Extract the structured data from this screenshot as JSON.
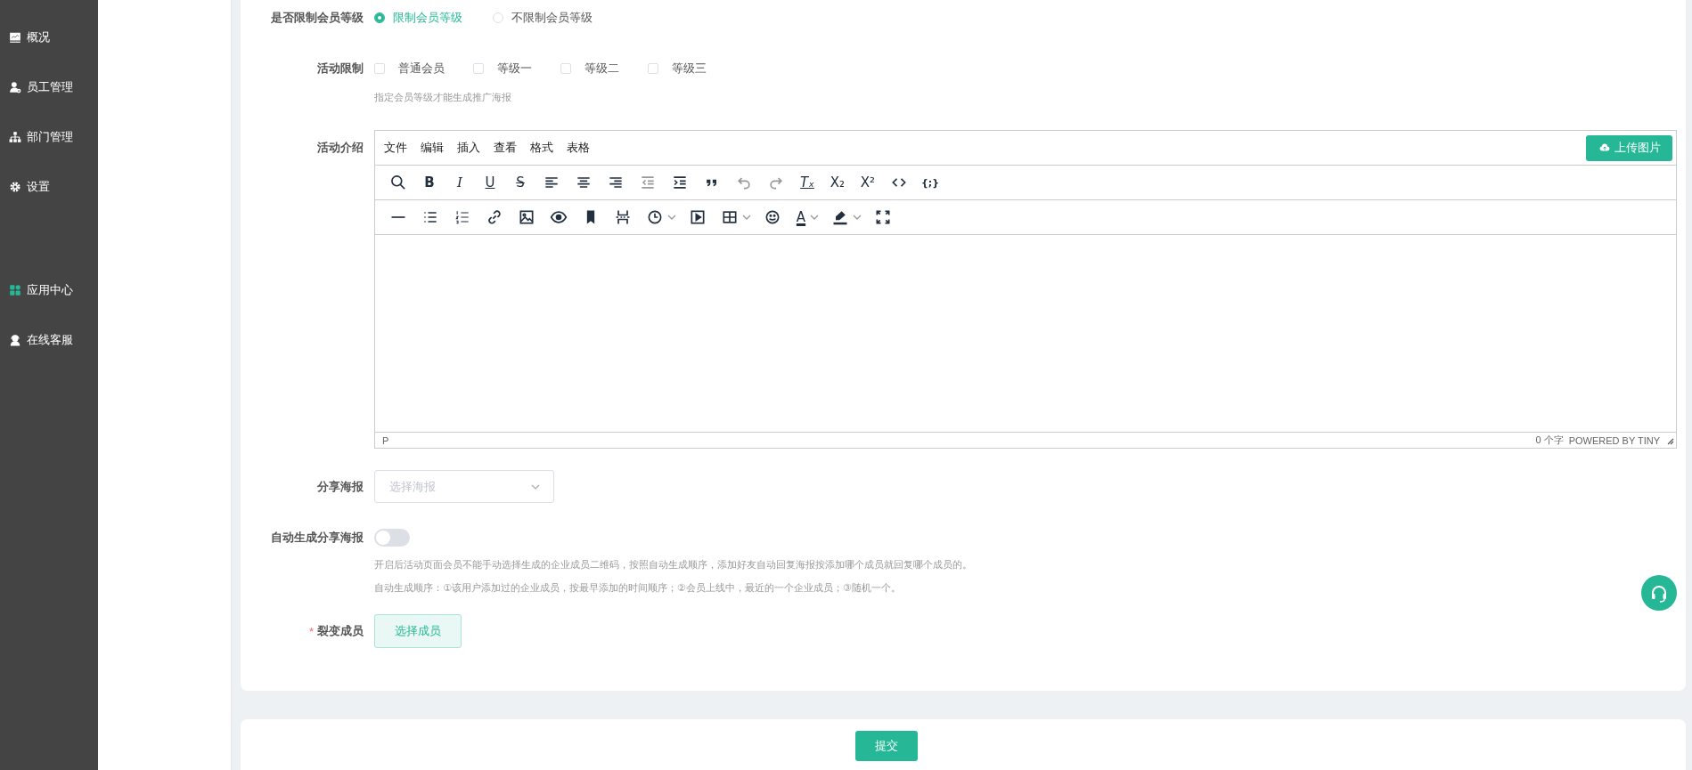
{
  "sidebar": {
    "items": [
      {
        "label": "概况",
        "kind": "chart"
      },
      {
        "label": "员工管理",
        "kind": "staff"
      },
      {
        "label": "部门管理",
        "kind": "org"
      },
      {
        "label": "设置",
        "kind": "gear"
      },
      {
        "label": "应用中心",
        "kind": "apps"
      },
      {
        "label": "在线客服",
        "kind": "agent"
      }
    ]
  },
  "form": {
    "member_limit": {
      "label": "是否限制会员等级",
      "options": [
        {
          "label": "限制会员等级",
          "selected": true
        },
        {
          "label": "不限制会员等级",
          "selected": false
        }
      ]
    },
    "activity_limit": {
      "label": "活动限制",
      "options": [
        {
          "label": "普通会员",
          "checked": false
        },
        {
          "label": "等级一",
          "checked": false
        },
        {
          "label": "等级二",
          "checked": false
        },
        {
          "label": "等级三",
          "checked": false
        }
      ],
      "hint": "指定会员等级才能生成推广海报"
    },
    "intro": {
      "label": "活动介绍",
      "editor": {
        "menus": [
          "文件",
          "编辑",
          "插入",
          "查看",
          "格式",
          "表格"
        ],
        "upload_button": "上传图片",
        "toolbar_rows": [
          [
            {
              "kind": "search",
              "disabled": false
            },
            {
              "kind": "bold",
              "glyph": "B",
              "disabled": false
            },
            {
              "kind": "italic",
              "glyph": "I",
              "disabled": false
            },
            {
              "kind": "underline",
              "glyph": "U",
              "disabled": false
            },
            {
              "kind": "strike",
              "glyph": "S",
              "disabled": false
            },
            {
              "kind": "align-left",
              "disabled": false
            },
            {
              "kind": "align-center",
              "disabled": false
            },
            {
              "kind": "align-right",
              "disabled": false
            },
            {
              "kind": "outdent",
              "disabled": true
            },
            {
              "kind": "indent",
              "disabled": false
            },
            {
              "kind": "quote",
              "disabled": false
            },
            {
              "kind": "undo",
              "disabled": true
            },
            {
              "kind": "redo",
              "disabled": true
            },
            {
              "kind": "clear-format",
              "glyph": "Tₓ",
              "disabled": false
            },
            {
              "kind": "subscript",
              "glyph": "X₂",
              "disabled": false
            },
            {
              "kind": "superscript",
              "glyph": "X²",
              "disabled": false
            },
            {
              "kind": "code",
              "disabled": false
            },
            {
              "kind": "code-sample",
              "glyph": "{;}",
              "disabled": false
            }
          ],
          [
            {
              "kind": "hr",
              "disabled": false
            },
            {
              "kind": "bullet-list",
              "disabled": false
            },
            {
              "kind": "numbered-list",
              "disabled": false
            },
            {
              "kind": "link",
              "disabled": false
            },
            {
              "kind": "image",
              "disabled": false
            },
            {
              "kind": "preview",
              "disabled": false
            },
            {
              "kind": "bookmark",
              "disabled": false
            },
            {
              "kind": "page-break",
              "disabled": false
            },
            {
              "kind": "clock",
              "dropdown": true,
              "disabled": false
            },
            {
              "kind": "media",
              "disabled": false
            },
            {
              "kind": "table",
              "dropdown": true,
              "disabled": false
            },
            {
              "kind": "emoji",
              "disabled": false
            },
            {
              "kind": "text-color",
              "glyph": "A",
              "dropdown": true,
              "disabled": false
            },
            {
              "kind": "highlight",
              "dropdown": true,
              "disabled": false
            },
            {
              "kind": "fullscreen",
              "disabled": false
            }
          ]
        ],
        "status_path": "P",
        "word_count": "0 个字",
        "branding": "POWERED BY TINY"
      }
    },
    "share_poster": {
      "label": "分享海报",
      "placeholder": "选择海报"
    },
    "auto_poster": {
      "label": "自动生成分享海报",
      "on": false,
      "hints": [
        "开启后活动页面会员不能手动选择生成的企业成员二维码，按照自动生成顺序，添加好友自动回复海报按添加哪个成员就回复哪个成员的。",
        "自动生成顺序：①该用户添加过的企业成员，按最早添加的时间顺序；②会员上线中，最近的一个企业成员；③随机一个。"
      ]
    },
    "members": {
      "label": "裂变成员",
      "required_mark": "*",
      "button": "选择成员"
    }
  },
  "submit": "提交"
}
